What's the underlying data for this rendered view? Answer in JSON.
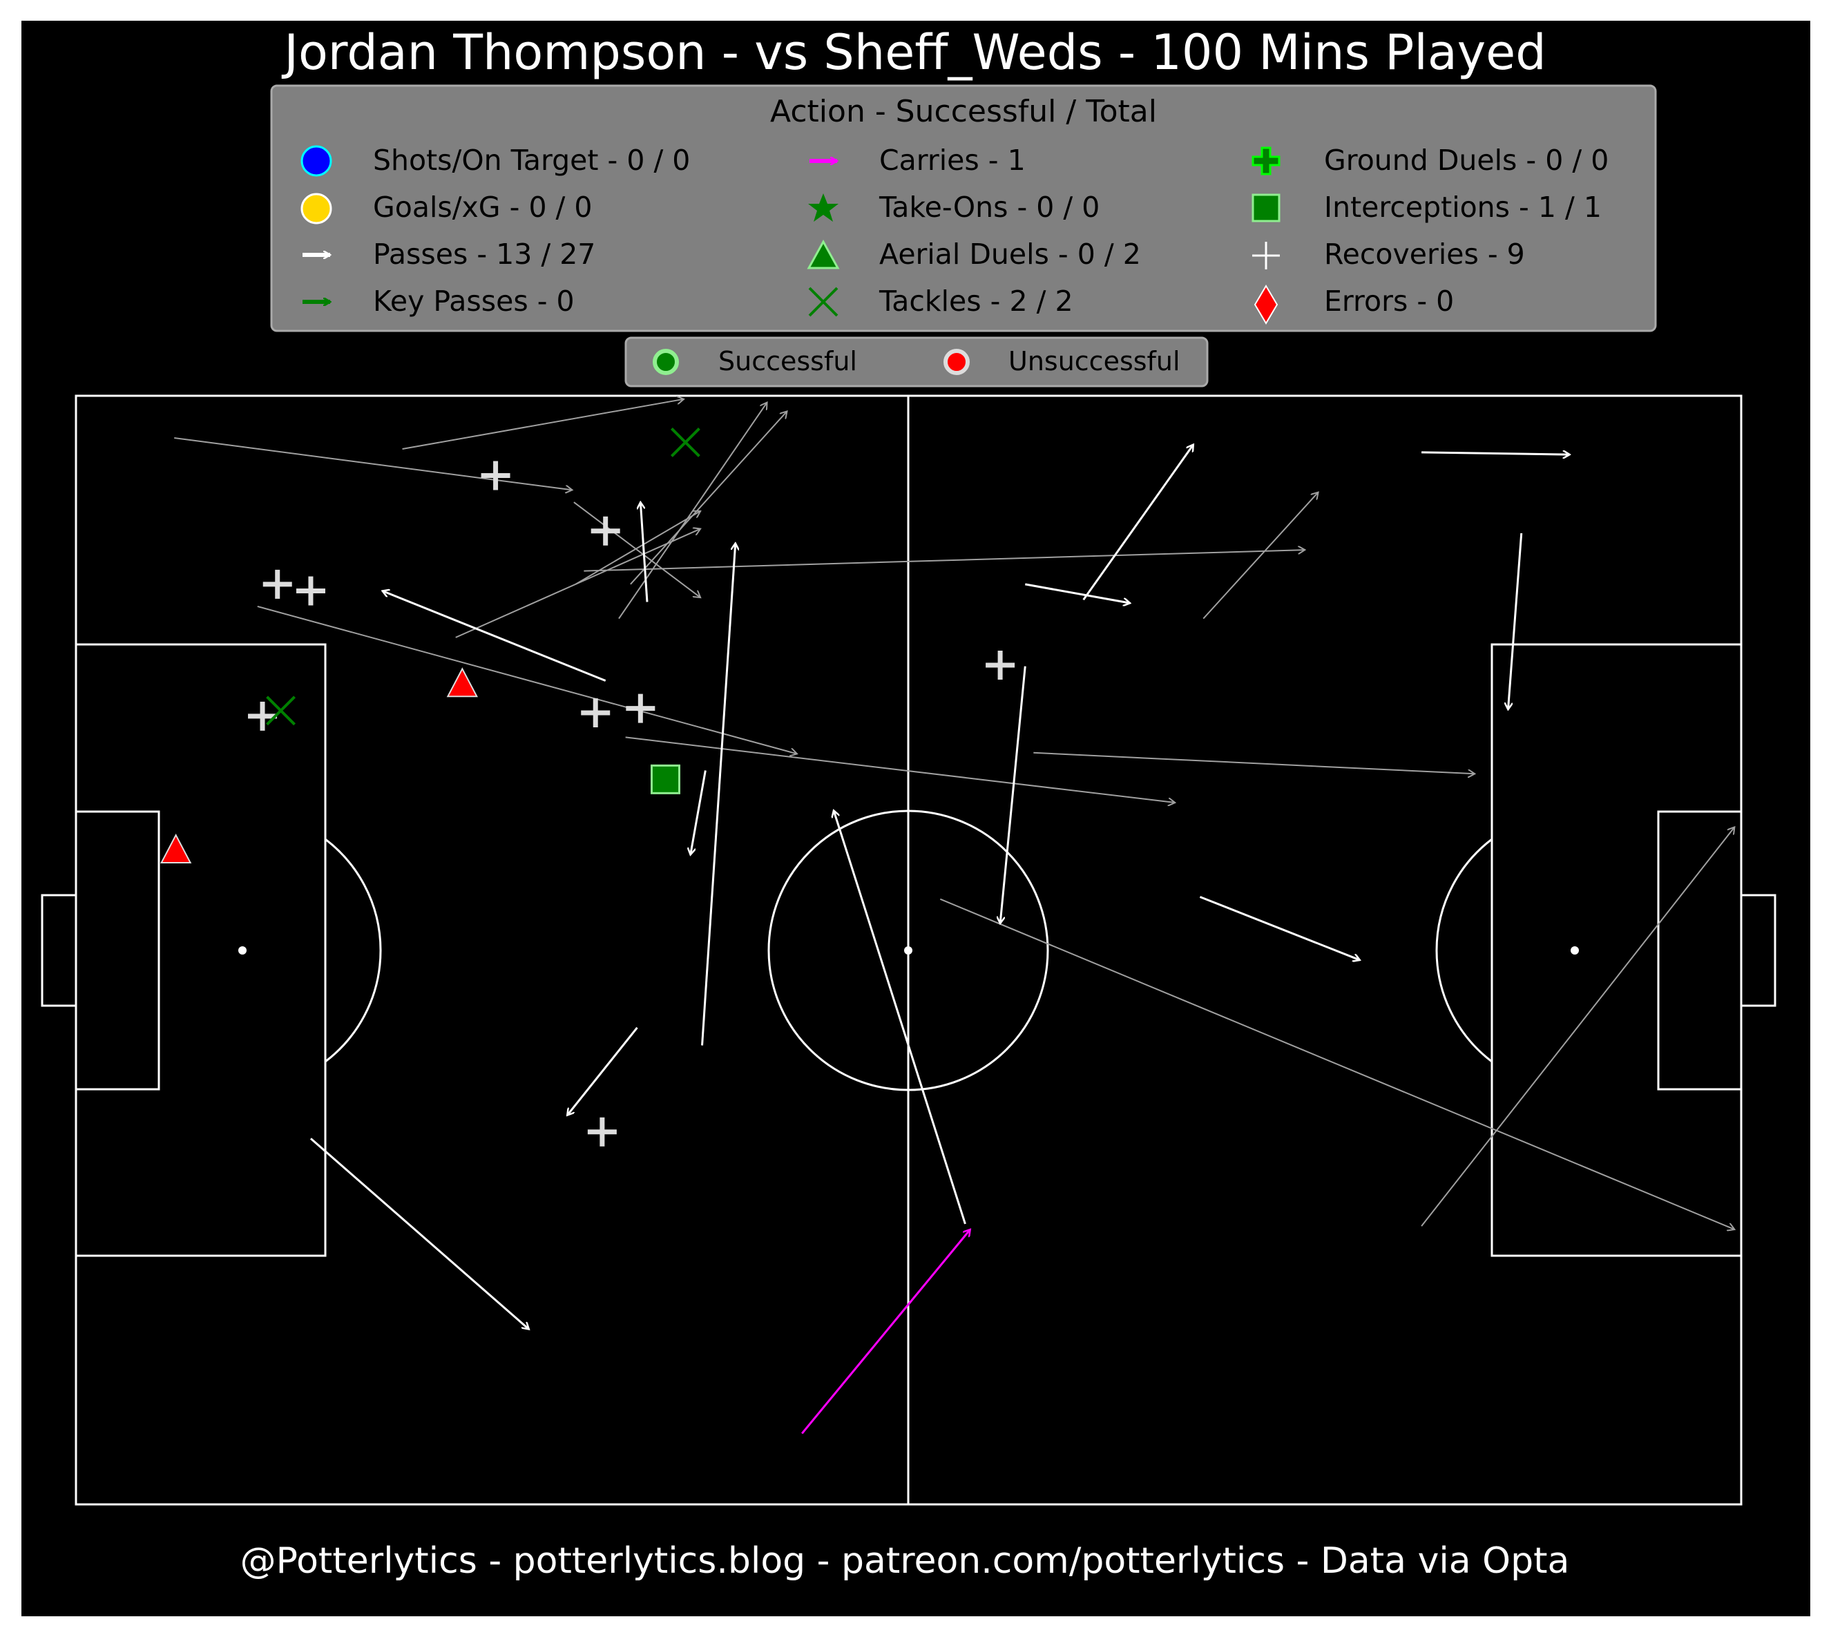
{
  "title": "Jordan Thompson - vs Sheff_Weds - 100 Mins Played",
  "footer": "@Potterlytics - potterlytics.blog - patreon.com/potterlytics - Data via Opta",
  "legend": {
    "title": "Action - Successful / Total",
    "entries": [
      {
        "label": "Shots/On Target - 0 / 0",
        "icon": "shot-marker-icon",
        "color": "#0000ff"
      },
      {
        "label": "Goals/xG - 0 / 0",
        "icon": "goal-marker-icon",
        "color": "#ffd700"
      },
      {
        "label": "Passes - 13 / 27",
        "icon": "pass-arrow-icon",
        "color": "#ffffff"
      },
      {
        "label": "Key Passes - 0",
        "icon": "key-pass-arrow-icon",
        "color": "#008000"
      },
      {
        "label": "Carries - 1",
        "icon": "carry-arrow-icon",
        "color": "#ff00ff"
      },
      {
        "label": "Take-Ons - 0 / 0",
        "icon": "star-icon",
        "color": "#008000"
      },
      {
        "label": "Aerial Duels - 0 / 2",
        "icon": "triangle-icon",
        "color": "#008000"
      },
      {
        "label": "Tackles - 2 / 2",
        "icon": "x-icon",
        "color": "#008000"
      },
      {
        "label": "Ground Duels - 0 / 0",
        "icon": "plus-fill-icon",
        "color": "#008000"
      },
      {
        "label": "Interceptions - 1 / 1",
        "icon": "square-icon",
        "color": "#008000"
      },
      {
        "label": "Recoveries - 9",
        "icon": "plus-icon",
        "color": "#ffffff"
      },
      {
        "label": "Errors - 0",
        "icon": "diamond-icon",
        "color": "#ff0000"
      }
    ]
  },
  "status_legend": {
    "successful": "Successful",
    "unsuccessful": "Unsuccessful",
    "successful_color": "#008000",
    "unsuccessful_color": "#ff0000"
  },
  "colors": {
    "background": "#000000",
    "pitch_lines": "#ffffff",
    "legend_bg": "#808080",
    "pass_success": "#ffffff",
    "pass_fail": "#a0a0a0",
    "carry": "#ff00ff"
  },
  "chart_data": {
    "type": "scatter",
    "pitch": {
      "length": 100,
      "width": 100
    },
    "passes": [
      {
        "x1": 5.9,
        "y1": 96.2,
        "x2": 29.8,
        "y2": 91.5,
        "outcome": "unsuccessful"
      },
      {
        "x1": 19.6,
        "y1": 95.2,
        "x2": 36.5,
        "y2": 99.7,
        "outcome": "unsuccessful"
      },
      {
        "x1": 29.9,
        "y1": 90.4,
        "x2": 37.5,
        "y2": 81.8,
        "outcome": "unsuccessful"
      },
      {
        "x1": 30.5,
        "y1": 84.2,
        "x2": 73.8,
        "y2": 86.1,
        "outcome": "unsuccessful"
      },
      {
        "x1": 30.0,
        "y1": 83.0,
        "x2": 37.5,
        "y2": 89.6,
        "outcome": "unsuccessful"
      },
      {
        "x1": 32.6,
        "y1": 79.9,
        "x2": 41.5,
        "y2": 99.4,
        "outcome": "unsuccessful"
      },
      {
        "x1": 33.3,
        "y1": 83.0,
        "x2": 42.7,
        "y2": 98.6,
        "outcome": "unsuccessful"
      },
      {
        "x1": 22.8,
        "y1": 78.2,
        "x2": 37.5,
        "y2": 88.0,
        "outcome": "unsuccessful"
      },
      {
        "x1": 10.9,
        "y1": 81.0,
        "x2": 43.3,
        "y2": 67.7,
        "outcome": "unsuccessful"
      },
      {
        "x1": 33.0,
        "y1": 69.2,
        "x2": 66.0,
        "y2": 63.3,
        "outcome": "unsuccessful"
      },
      {
        "x1": 57.5,
        "y1": 67.8,
        "x2": 84.0,
        "y2": 65.9,
        "outcome": "unsuccessful"
      },
      {
        "x1": 67.7,
        "y1": 79.9,
        "x2": 74.6,
        "y2": 91.3,
        "outcome": "unsuccessful"
      },
      {
        "x1": 51.9,
        "y1": 54.6,
        "x2": 99.6,
        "y2": 24.8,
        "outcome": "unsuccessful"
      },
      {
        "x1": 80.8,
        "y1": 25.1,
        "x2": 99.6,
        "y2": 61.1,
        "outcome": "unsuccessful"
      },
      {
        "x1": 34.3,
        "y1": 81.4,
        "x2": 33.9,
        "y2": 90.4,
        "outcome": "successful"
      },
      {
        "x1": 31.8,
        "y1": 74.3,
        "x2": 18.4,
        "y2": 82.4,
        "outcome": "successful"
      },
      {
        "x1": 37.8,
        "y1": 66.2,
        "x2": 36.9,
        "y2": 58.6,
        "outcome": "successful"
      },
      {
        "x1": 37.6,
        "y1": 41.4,
        "x2": 39.6,
        "y2": 86.7,
        "outcome": "successful"
      },
      {
        "x1": 33.7,
        "y1": 43.0,
        "x2": 29.5,
        "y2": 35.1,
        "outcome": "successful"
      },
      {
        "x1": 14.1,
        "y1": 33.0,
        "x2": 27.2,
        "y2": 15.8,
        "outcome": "successful"
      },
      {
        "x1": 53.4,
        "y1": 25.3,
        "x2": 45.5,
        "y2": 62.6,
        "outcome": "successful"
      },
      {
        "x1": 57.0,
        "y1": 75.6,
        "x2": 55.5,
        "y2": 52.4,
        "outcome": "successful"
      },
      {
        "x1": 57.0,
        "y1": 83.0,
        "x2": 63.3,
        "y2": 81.3,
        "outcome": "successful"
      },
      {
        "x1": 60.5,
        "y1": 81.6,
        "x2": 67.1,
        "y2": 95.6,
        "outcome": "successful"
      },
      {
        "x1": 80.8,
        "y1": 94.9,
        "x2": 89.7,
        "y2": 94.7,
        "outcome": "successful"
      },
      {
        "x1": 86.8,
        "y1": 87.6,
        "x2": 86.0,
        "y2": 71.7,
        "outcome": "successful"
      },
      {
        "x1": 67.5,
        "y1": 54.8,
        "x2": 77.1,
        "y2": 49.1,
        "outcome": "successful"
      }
    ],
    "carries": [
      {
        "x1": 43.6,
        "y1": 6.4,
        "x2": 53.7,
        "y2": 24.8
      }
    ],
    "recoveries": [
      {
        "x": 25.2,
        "y": 92.8
      },
      {
        "x": 31.8,
        "y": 87.8
      },
      {
        "x": 12.1,
        "y": 83.0
      },
      {
        "x": 14.1,
        "y": 82.4
      },
      {
        "x": 31.2,
        "y": 71.4
      },
      {
        "x": 33.9,
        "y": 71.8
      },
      {
        "x": 11.2,
        "y": 71.1
      },
      {
        "x": 55.5,
        "y": 75.7
      },
      {
        "x": 31.6,
        "y": 33.6
      }
    ],
    "tackles": [
      {
        "x": 36.6,
        "y": 95.8,
        "outcome": "successful"
      },
      {
        "x": 12.3,
        "y": 71.6,
        "outcome": "successful"
      }
    ],
    "aerial_duels": [
      {
        "x": 23.2,
        "y": 74.0,
        "outcome": "unsuccessful"
      },
      {
        "x": 6.0,
        "y": 59.0,
        "outcome": "unsuccessful"
      }
    ],
    "interceptions": [
      {
        "x": 35.4,
        "y": 65.4,
        "outcome": "successful"
      }
    ]
  }
}
